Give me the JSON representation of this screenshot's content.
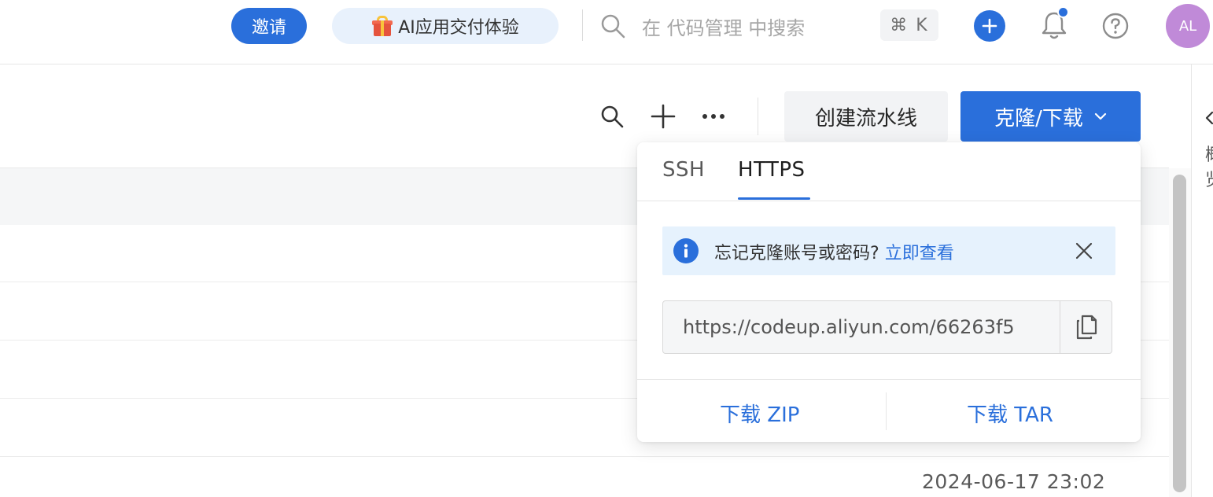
{
  "header": {
    "invite_label": "邀请",
    "promo_label": "AI应用交付体验",
    "search_placeholder": "在 代码管理 中搜索",
    "shortcut": "⌘ K",
    "avatar_initials": "AL"
  },
  "toolbar": {
    "create_pipeline_label": "创建流水线",
    "clone_download_label": "克隆/下载"
  },
  "clone_dropdown": {
    "tabs": [
      {
        "label": "SSH",
        "active": false
      },
      {
        "label": "HTTPS",
        "active": true
      }
    ],
    "alert": {
      "text": "忘记克隆账号或密码?",
      "link": "立即查看"
    },
    "url_value": "https://codeup.aliyun.com/66263f5",
    "download_zip_label": "下载 ZIP",
    "download_tar_label": "下载 TAR"
  },
  "table": {
    "visible_date": "2024-06-17 23:02"
  },
  "side_panel": {
    "text": "概览"
  },
  "colors": {
    "accent": "#2a6fdb",
    "alert_bg": "#e6f2fd",
    "avatar_bg": "#c08ad8"
  }
}
